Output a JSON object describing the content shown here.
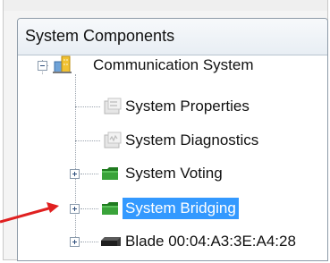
{
  "panel": {
    "title": "System Components"
  },
  "tree": {
    "root": {
      "label": "Communication System",
      "expanded": true,
      "icon": "building-icon"
    },
    "items": [
      {
        "label": "System Properties",
        "icon": "properties-icon",
        "has_children": false
      },
      {
        "label": "System Diagnostics",
        "icon": "diagnostics-icon",
        "has_children": false
      },
      {
        "label": "System Voting",
        "icon": "folder-icon",
        "has_children": true,
        "expanded": false
      },
      {
        "label": "System Bridging",
        "icon": "folder-icon",
        "has_children": true,
        "expanded": false,
        "selected": true
      },
      {
        "label": "Blade 00:04:A3:3E:A4:28",
        "icon": "blade-icon",
        "has_children": true,
        "expanded": false
      }
    ]
  },
  "annotation": {
    "arrow_color": "#e02020"
  },
  "colors": {
    "selection": "#3399ff",
    "folder": "#2e8b2e"
  }
}
